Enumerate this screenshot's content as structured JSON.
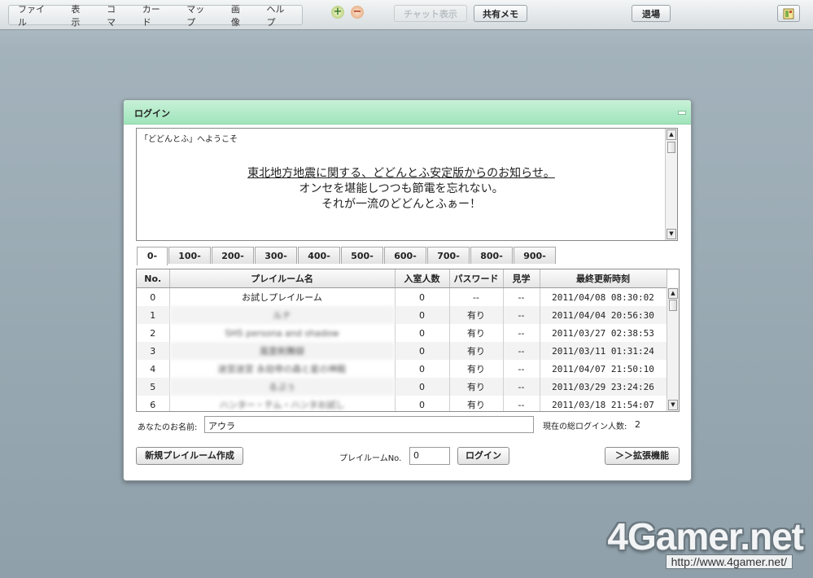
{
  "menu": [
    "ファイル",
    "表示",
    "コマ",
    "カード",
    "マップ",
    "画像",
    "ヘルプ"
  ],
  "toolbar": {
    "zoom_in": "+",
    "zoom_out": "−",
    "disabled_button": "チャット表示",
    "memo_button": "共有メモ",
    "exit_button": "退場"
  },
  "dialog": {
    "title": "ログイン",
    "greeting": "「どどんとふ」へようこそ",
    "message": {
      "link": "東北地方地震に関する、どどんとふ安定版からのお知らせ。",
      "line2": "オンセを堪能しつつも節電を忘れない。",
      "line3": "それが一流のどどんとふぁー！"
    },
    "tabs": [
      "0-",
      "100-",
      "200-",
      "300-",
      "400-",
      "500-",
      "600-",
      "700-",
      "800-",
      "900-"
    ],
    "table": {
      "headers": [
        "No.",
        "プレイルーム名",
        "入室人数",
        "パスワード",
        "見学",
        "最終更新時刻"
      ],
      "rows": [
        {
          "no": "0",
          "name": "お試しプレイルーム",
          "count": "0",
          "password": "--",
          "observe": "--",
          "updated": "2011/04/08 08:30:02"
        },
        {
          "no": "1",
          "name": "ルナ",
          "count": "0",
          "password": "有り",
          "observe": "--",
          "updated": "2011/04/04 20:56:30"
        },
        {
          "no": "2",
          "name": "SHS persona and shadow",
          "count": "0",
          "password": "有り",
          "observe": "--",
          "updated": "2011/03/27 02:38:53"
        },
        {
          "no": "3",
          "name": "風雲剣舞録",
          "count": "0",
          "password": "有り",
          "observe": "--",
          "updated": "2011/03/11 01:31:24"
        },
        {
          "no": "4",
          "name": "迷宮迷宮 永劫帝の森と星の神殿",
          "count": "0",
          "password": "有り",
          "observe": "--",
          "updated": "2011/04/07 21:50:10"
        },
        {
          "no": "5",
          "name": "るぷぅ",
          "count": "0",
          "password": "有り",
          "observe": "--",
          "updated": "2011/03/29 23:24:26"
        },
        {
          "no": "6",
          "name": "ハンター・テム・ハンタお試し",
          "count": "0",
          "password": "有り",
          "observe": "--",
          "updated": "2011/03/18 21:54:07"
        }
      ]
    },
    "name_label": "あなたのお名前:",
    "name_value": "アウラ",
    "login_count_label": "現在の総ログイン人数:",
    "login_count": "2",
    "create_button": "新規プレイルーム作成",
    "room_no_label": "プレイルームNo.",
    "room_no_value": "0",
    "login_button": "ログイン",
    "extend_button": "＞＞拡張機能"
  },
  "watermark": {
    "logo": "4Gamer.net",
    "url": "http://www.4gamer.net/"
  }
}
